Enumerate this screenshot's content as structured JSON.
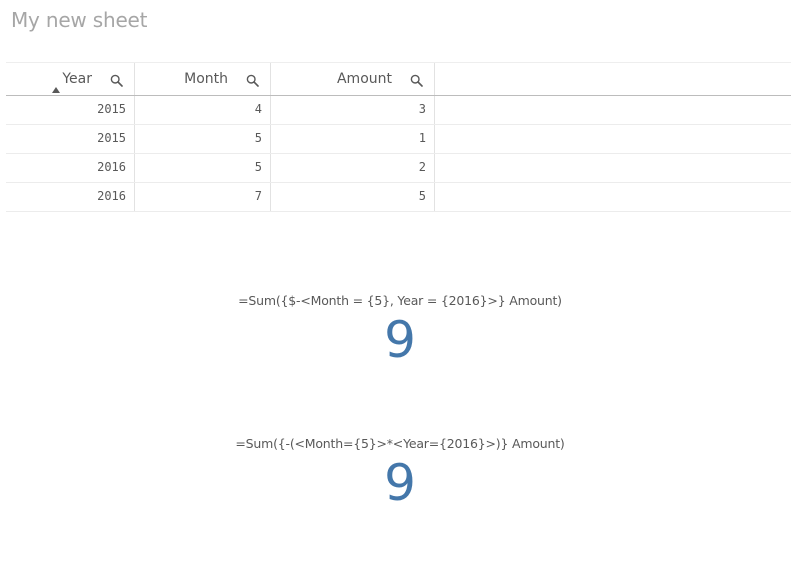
{
  "sheet": {
    "title": "My new sheet"
  },
  "table": {
    "columns": [
      {
        "label": "Year",
        "sorted": "ascending"
      },
      {
        "label": "Month"
      },
      {
        "label": "Amount"
      }
    ],
    "rows": [
      [
        "2015",
        "4",
        "3"
      ],
      [
        "2015",
        "5",
        "1"
      ],
      [
        "2016",
        "5",
        "2"
      ],
      [
        "2016",
        "7",
        "5"
      ]
    ]
  },
  "kpis": [
    {
      "expression": "=Sum({$-<Month = {5}, Year = {2016}>} Amount)",
      "value": "9"
    },
    {
      "expression": "=Sum({-(<Month={5}>*<Year={2016}>)} Amount)",
      "value": "9"
    }
  ],
  "colors": {
    "kpi_value": "#4477aa",
    "title": "#a6a6a6",
    "text": "#595959"
  }
}
